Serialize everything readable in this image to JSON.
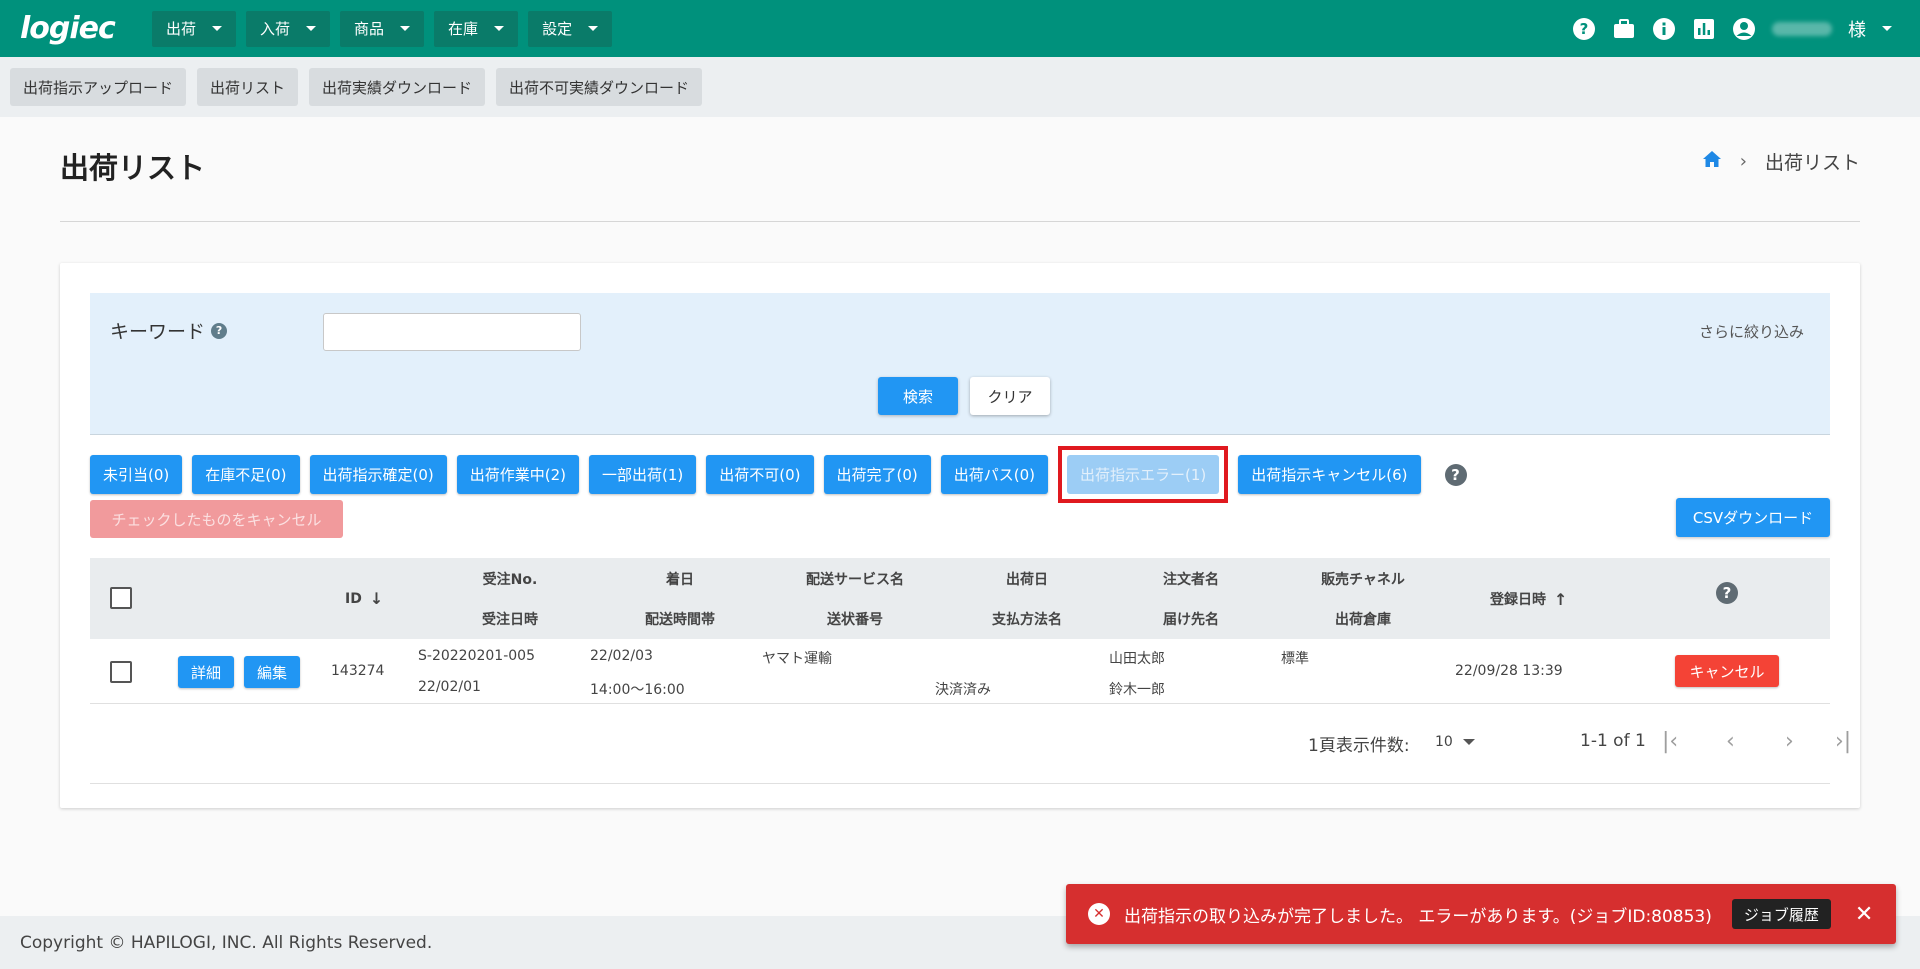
{
  "app": {
    "logo": "logiec"
  },
  "nav": {
    "items": [
      {
        "label": "出荷"
      },
      {
        "label": "入荷"
      },
      {
        "label": "商品"
      },
      {
        "label": "在庫"
      },
      {
        "label": "設定"
      }
    ],
    "user_suffix": "様"
  },
  "toolbar": {
    "items": [
      {
        "label": "出荷指示アップロード"
      },
      {
        "label": "出荷リスト"
      },
      {
        "label": "出荷実績ダウンロード"
      },
      {
        "label": "出荷不可実績ダウンロード"
      }
    ]
  },
  "page": {
    "title": "出荷リスト",
    "breadcrumb_current": "出荷リスト"
  },
  "search": {
    "keyword_label": "キーワード",
    "keyword_value": "",
    "more_filters": "さらに絞り込み",
    "search_button": "検索",
    "clear_button": "クリア"
  },
  "status_filters": [
    {
      "label": "未引当(0)"
    },
    {
      "label": "在庫不足(0)"
    },
    {
      "label": "出荷指示確定(0)"
    },
    {
      "label": "出荷作業中(2)"
    },
    {
      "label": "一部出荷(1)"
    },
    {
      "label": "出荷不可(0)"
    },
    {
      "label": "出荷完了(0)"
    },
    {
      "label": "出荷パス(0)"
    },
    {
      "label": "出荷指示エラー(1)"
    },
    {
      "label": "出荷指示キャンセル(6)"
    }
  ],
  "actions": {
    "cancel_checked": "チェックしたものをキャンセル",
    "csv_download": "CSVダウンロード"
  },
  "table": {
    "headers": {
      "id": "ID",
      "order_no": "受注No.",
      "order_date": "受注日時",
      "arrival_date": "着日",
      "delivery_time": "配送時間帯",
      "delivery_service": "配送サービス名",
      "tracking_no": "送状番号",
      "ship_date": "出荷日",
      "payment_method": "支払方法名",
      "orderer": "注文者名",
      "recipient": "届け先名",
      "sales_channel": "販売チャネル",
      "warehouse": "出荷倉庫",
      "registered_at": "登録日時"
    },
    "rows": [
      {
        "detail_button": "詳細",
        "edit_button": "編集",
        "id": "143274",
        "order_no": "S-20220201-005",
        "order_date": "22/02/01",
        "arrival_date": "22/02/03",
        "delivery_time": "14:00〜16:00",
        "delivery_service": "ヤマト運輸",
        "tracking_no": "",
        "ship_date": "",
        "payment_method": "決済済み",
        "orderer": "山田太郎",
        "recipient": "鈴木一郎",
        "sales_channel": "標準",
        "warehouse": "",
        "registered_at": "22/09/28 13:39",
        "cancel_button": "キャンセル"
      }
    ]
  },
  "pagination": {
    "per_page_label": "1頁表示件数:",
    "per_page_value": "10",
    "range": "1-1 of 1"
  },
  "footer": {
    "copyright": "Copyright © HAPILOGI, INC. All Rights Reserved."
  },
  "snackbar": {
    "message": "出荷指示の取り込みが完了しました。 エラーがあります。(ジョブID:80853)",
    "button": "ジョブ履歴"
  },
  "colors": {
    "header": "#00917c",
    "primary": "#2196f3",
    "danger": "#f44336",
    "snackbar": "#d62f2f"
  }
}
